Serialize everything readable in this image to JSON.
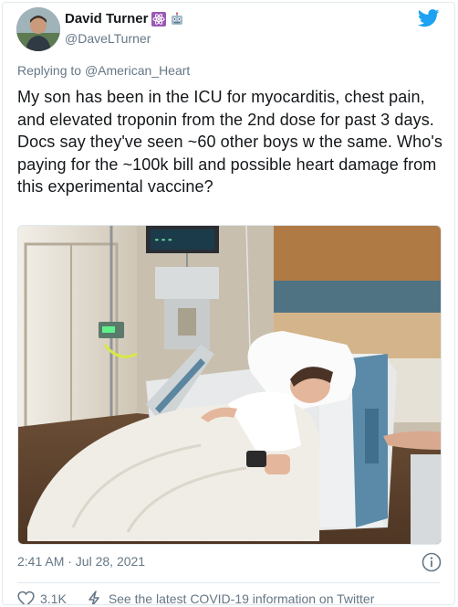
{
  "author": {
    "display_name": "David Turner",
    "handle": "@DaveLTurner",
    "name_emojis": [
      "atom-symbol-emoji",
      "robot-face-emoji"
    ]
  },
  "reply": {
    "prefix": "Replying to ",
    "target": "@American_Heart"
  },
  "tweet": {
    "text": "My son has been in the ICU for myocarditis, chest pain, and elevated troponin from the 2nd dose for past 3 days. Docs say they've seen ~60 other boys w the same. Who's paying for the ~100k bill and possible heart damage from this experimental vaccine?"
  },
  "media": {
    "icons": [
      "hospital-photo"
    ]
  },
  "meta": {
    "timestamp": "2:41 AM · Jul 28, 2021"
  },
  "actions": {
    "like_count": "3.1K",
    "covid_notice": "See the latest COVID-19 information on Twitter"
  },
  "colors": {
    "brand": "#1da1f2",
    "text": "#14171a",
    "secondary": "#657786",
    "border": "#e1e8ed"
  }
}
